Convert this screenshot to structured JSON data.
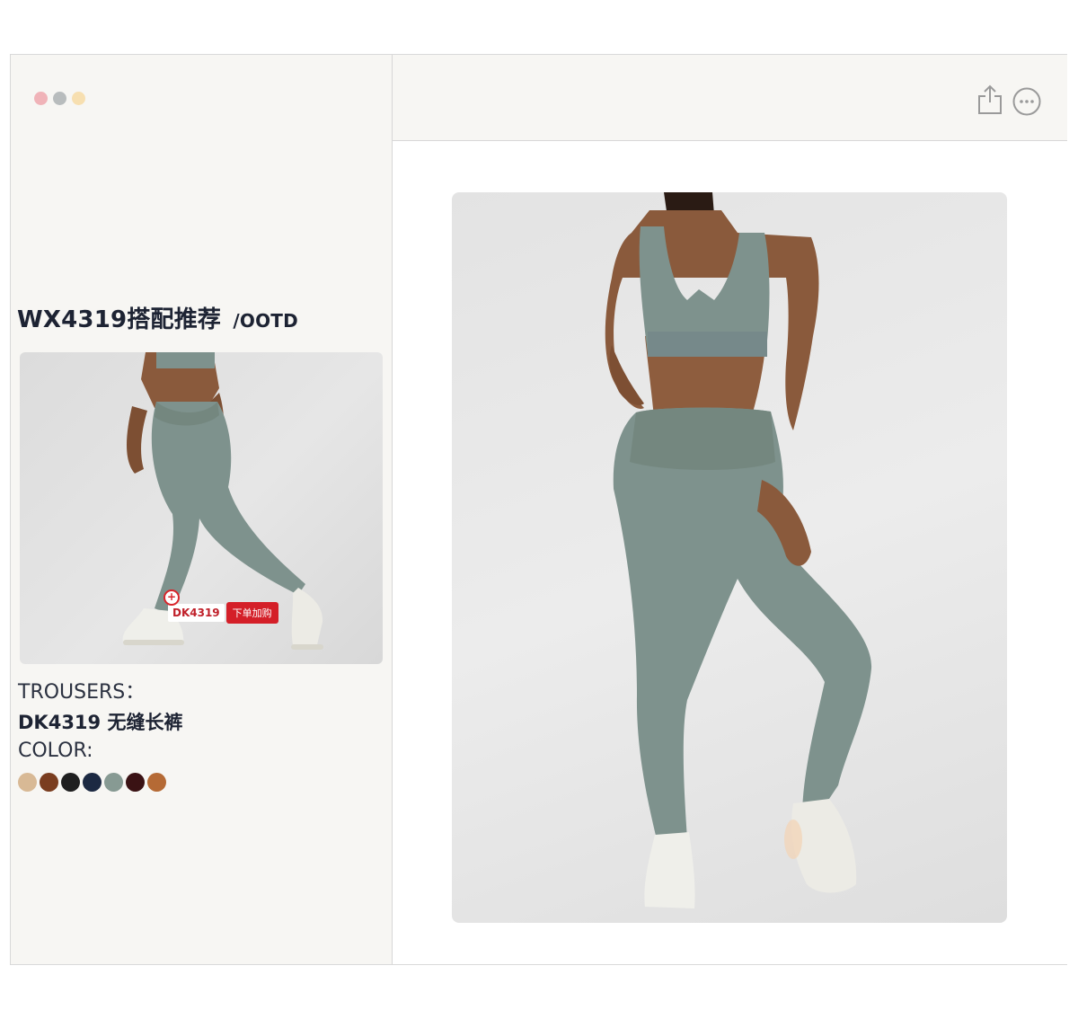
{
  "window": {
    "traffic_lights": [
      "#f0b3b8",
      "#b8bcbd",
      "#f7dfb0"
    ]
  },
  "left_panel": {
    "title": "WX4319搭配推荐",
    "title_suffix": "/OOTD",
    "thumbnail": {
      "tag_code": "DK4319",
      "tag_button": "下单加购",
      "tag_plus": "+"
    },
    "trousers_label": "TROUSERS：",
    "product_name": "DK4319 无缝长裤",
    "color_label": "COLOR:",
    "colors": [
      "#d8b995",
      "#7a3d1f",
      "#1f1f1f",
      "#1c2942",
      "#879a93",
      "#3a1214",
      "#b56a35"
    ]
  },
  "right_panel": {
    "toolbar": {
      "share_icon": "share-icon",
      "more_icon": "more-options-icon"
    },
    "accent_garment_color": "#7e928d"
  }
}
